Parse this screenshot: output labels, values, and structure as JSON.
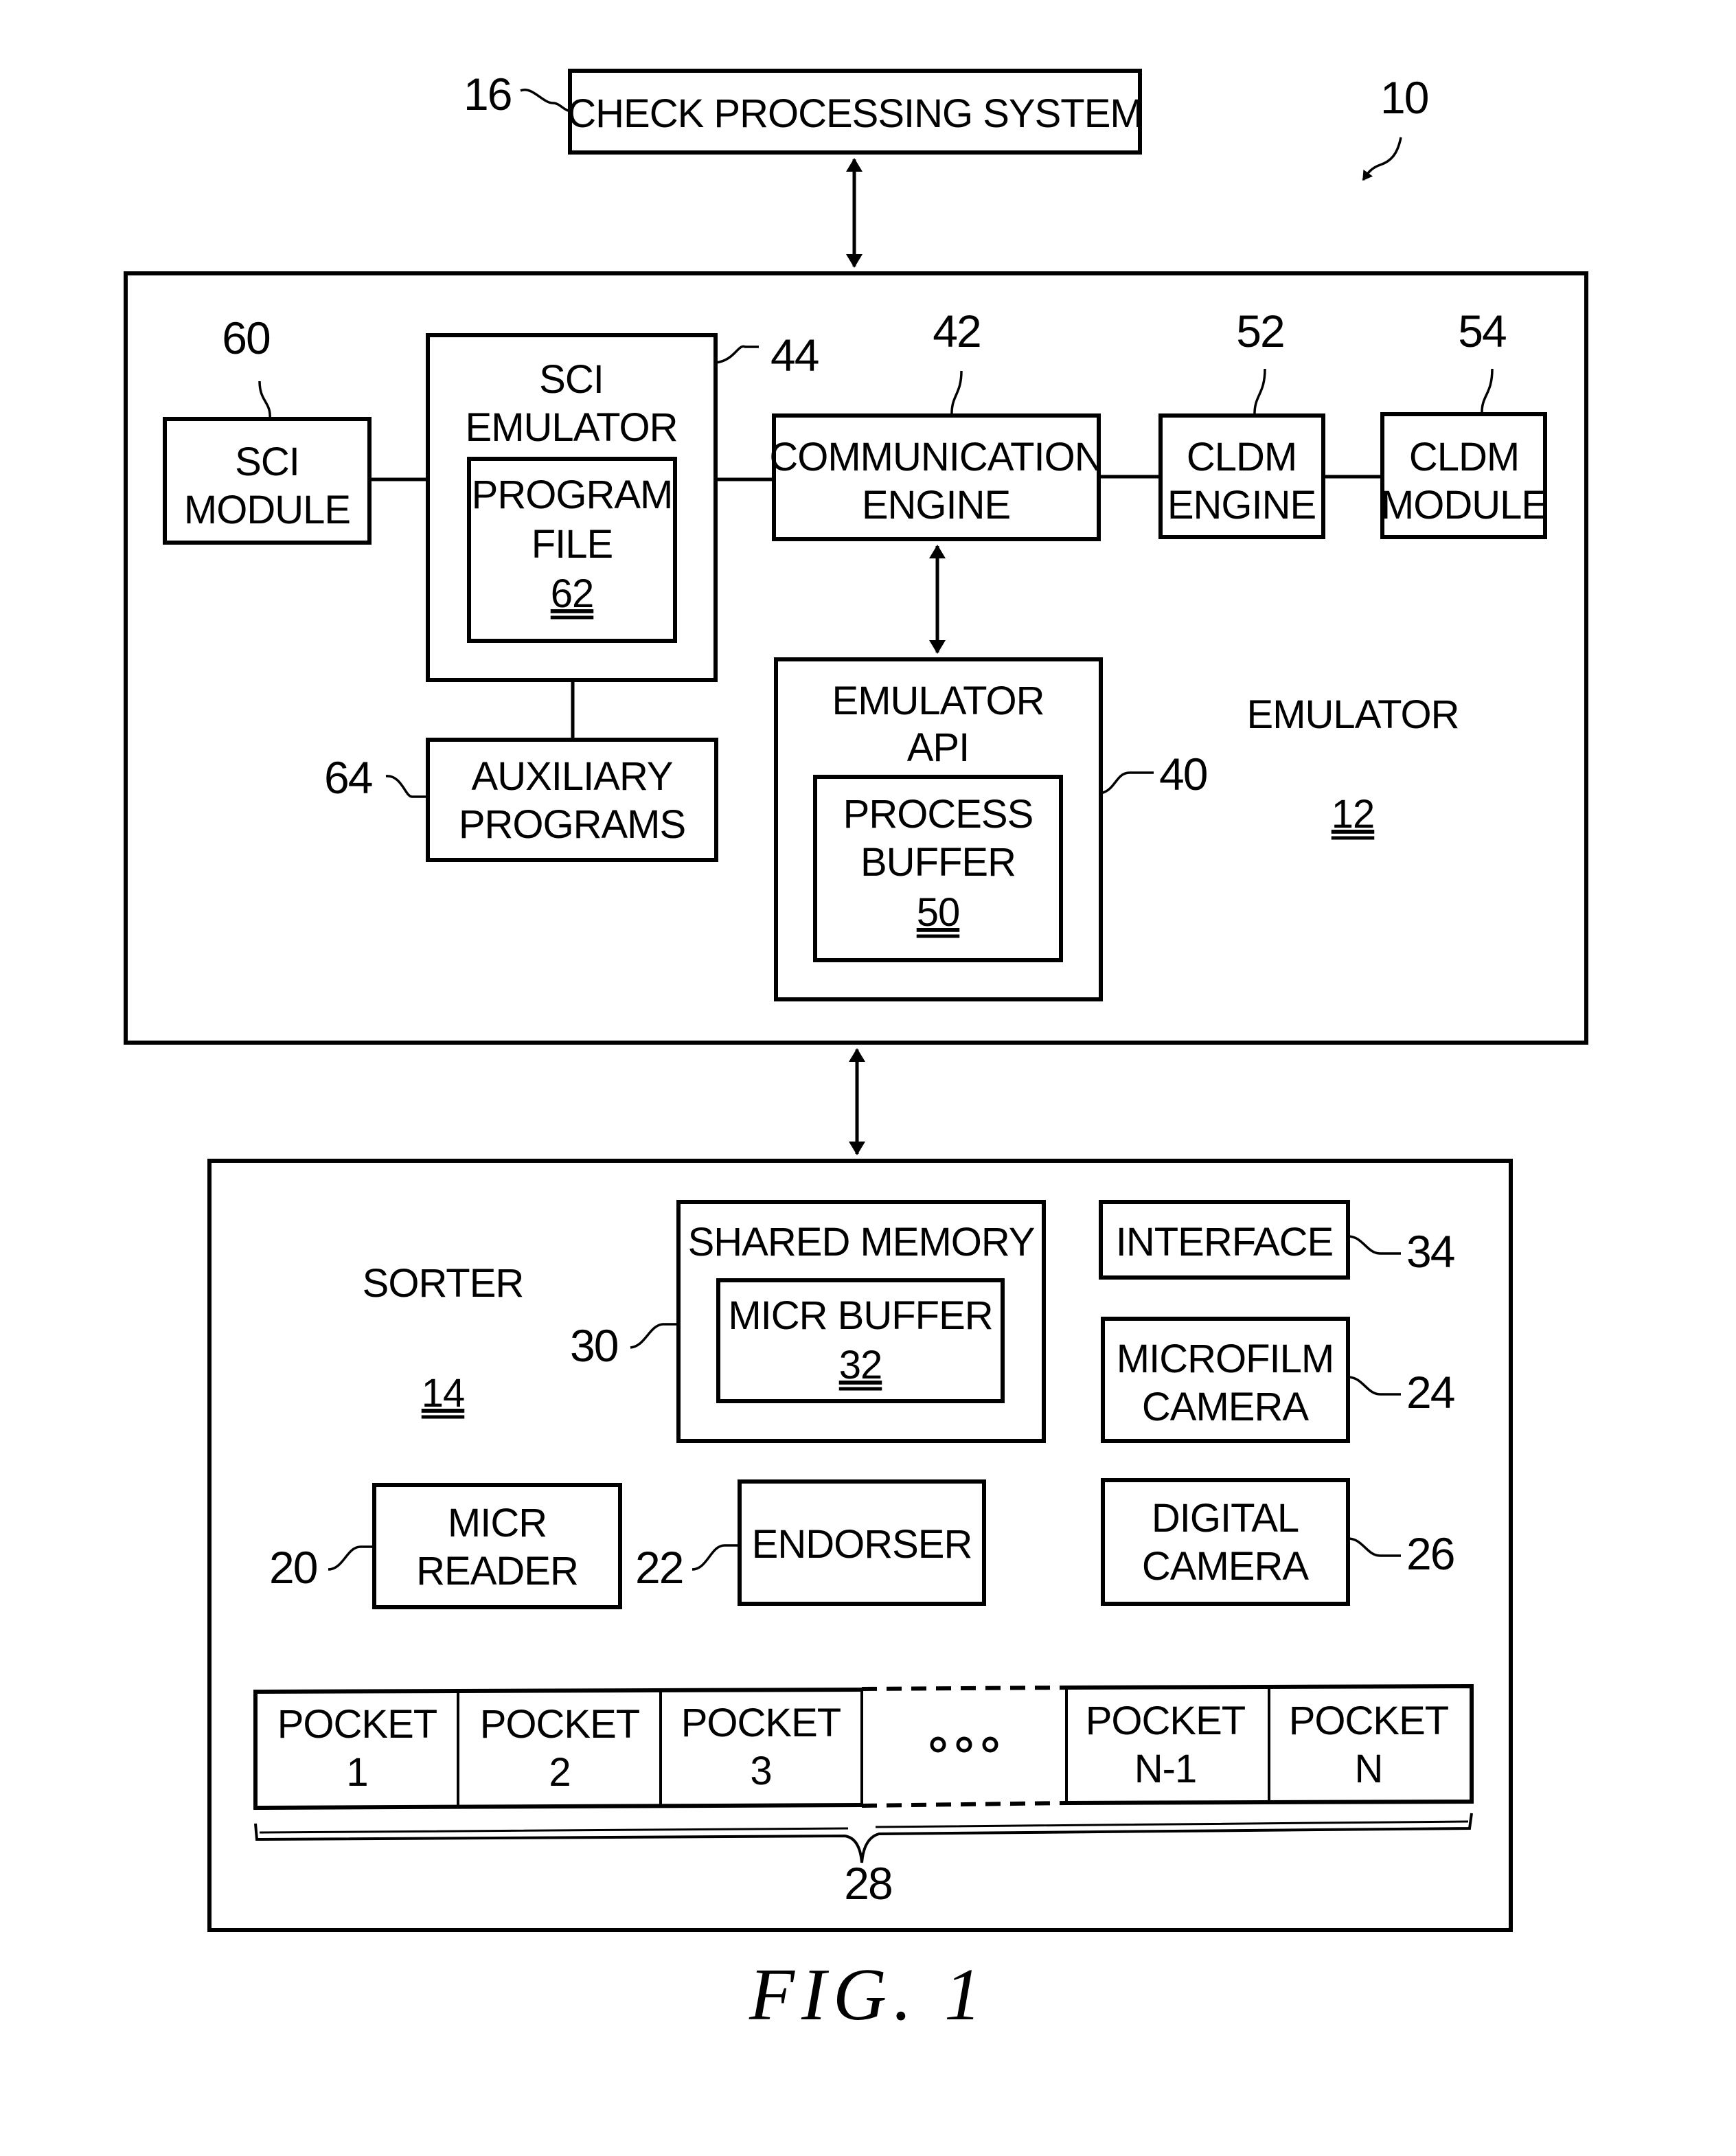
{
  "figure": {
    "caption": "FIG. 1",
    "system_ref": "10"
  },
  "check_processing": {
    "label": "CHECK PROCESSING SYSTEM",
    "ref": "16"
  },
  "emulator": {
    "label": "EMULATOR",
    "ref": "12",
    "sci_module": {
      "line1": "SCI",
      "line2": "MODULE",
      "ref": "60"
    },
    "sci_emulator": {
      "line1": "SCI",
      "line2": "EMULATOR",
      "ref": "44",
      "program_file": {
        "line1": "PROGRAM",
        "line2": "FILE",
        "ref": "62"
      }
    },
    "communication_engine": {
      "line1": "COMMUNICATION",
      "line2": "ENGINE",
      "ref": "42"
    },
    "cldm_engine": {
      "line1": "CLDM",
      "line2": "ENGINE",
      "ref": "52"
    },
    "cldm_module": {
      "line1": "CLDM",
      "line2": "MODULE",
      "ref": "54"
    },
    "auxiliary_programs": {
      "line1": "AUXILIARY",
      "line2": "PROGRAMS",
      "ref": "64"
    },
    "emulator_api": {
      "line1": "EMULATOR",
      "line2": "API",
      "ref": "40",
      "process_buffer": {
        "line1": "PROCESS",
        "line2": "BUFFER",
        "ref": "50"
      }
    }
  },
  "sorter": {
    "label": "SORTER",
    "ref": "14",
    "shared_memory": {
      "label": "SHARED MEMORY",
      "ref": "30",
      "micr_buffer": {
        "label": "MICR BUFFER",
        "ref": "32"
      }
    },
    "interface": {
      "label": "INTERFACE",
      "ref": "34"
    },
    "microfilm_camera": {
      "line1": "MICROFILM",
      "line2": "CAMERA",
      "ref": "24"
    },
    "digital_camera": {
      "line1": "DIGITAL",
      "line2": "CAMERA",
      "ref": "26"
    },
    "micr_reader": {
      "line1": "MICR",
      "line2": "READER",
      "ref": "20"
    },
    "endorser": {
      "label": "ENDORSER",
      "ref": "22"
    },
    "pockets": {
      "ref": "28",
      "ellipsis": "o o o",
      "items": [
        {
          "line1": "POCKET",
          "line2": "1"
        },
        {
          "line1": "POCKET",
          "line2": "2"
        },
        {
          "line1": "POCKET",
          "line2": "3"
        },
        {
          "line1": "POCKET",
          "line2": "N-1"
        },
        {
          "line1": "POCKET",
          "line2": "N"
        }
      ]
    }
  }
}
